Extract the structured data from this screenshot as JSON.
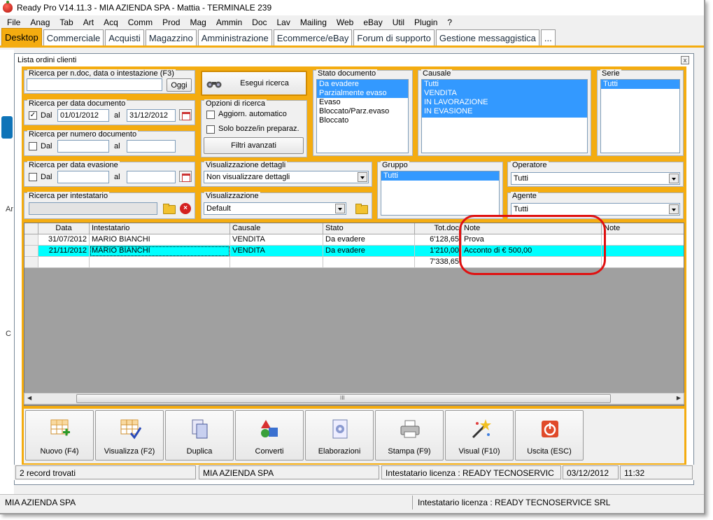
{
  "window": {
    "title": "Ready Pro V14.11.3 - MIA AZIENDA SPA - Mattia - TERMINALE 239"
  },
  "menu": [
    "File",
    "Anag",
    "Tab",
    "Art",
    "Acq",
    "Comm",
    "Prod",
    "Mag",
    "Ammin",
    "Doc",
    "Lav",
    "Mailing",
    "Web",
    "eBay",
    "Util",
    "Plugin",
    "?"
  ],
  "tabs": [
    "Desktop",
    "Commerciale",
    "Acquisti",
    "Magazzino",
    "Amministrazione",
    "Ecommerce/eBay",
    "Forum di supporto",
    "Gestione messaggistica",
    "..."
  ],
  "desk_left_letters": [
    "Ar",
    "C"
  ],
  "inner": {
    "title": "Lista ordini clienti",
    "close": "x"
  },
  "search": {
    "ndoc_title": "Ricerca per n.doc, data o intestazione (F3)",
    "ndoc_value": "",
    "oggi": "Oggi",
    "datadoc_title": "Ricerca per data documento",
    "dal": "Dal",
    "al": "al",
    "datadoc_checked": "✓",
    "datadoc_from": "01/01/2012",
    "datadoc_to": "31/12/2012",
    "numdoc_title": "Ricerca per numero documento",
    "dataev_title": "Ricerca per data evasione",
    "intest_title": "Ricerca per intestatario",
    "esegui": "Esegui ricerca",
    "opzioni_title": "Opzioni di ricerca",
    "opt_aggiorn": "Aggiorn. automatico",
    "opt_bozze": "Solo bozze/in preparaz.",
    "filtri": "Filtri avanzati",
    "visdett_title": "Visualizzazione dettagli",
    "visdett_value": "Non visualizzare dettagli",
    "vis_title": "Visualizzazione",
    "vis_value": "Default"
  },
  "stato": {
    "title": "Stato documento",
    "items": [
      {
        "label": "Da evadere",
        "sel": true
      },
      {
        "label": "Parzialmente evaso",
        "sel": true
      },
      {
        "label": "Evaso",
        "sel": false
      },
      {
        "label": "Bloccato/Parz.evaso",
        "sel": false
      },
      {
        "label": "Bloccato",
        "sel": false
      }
    ]
  },
  "causale": {
    "title": "Causale",
    "items": [
      "Tutti",
      "VENDITA",
      "IN LAVORAZIONE",
      "IN EVASIONE"
    ]
  },
  "serie": {
    "title": "Serie",
    "items": [
      "Tutti"
    ]
  },
  "gruppo": {
    "title": "Gruppo",
    "items": [
      "Tutti"
    ]
  },
  "operatore": {
    "title": "Operatore",
    "value": "Tutti"
  },
  "agente": {
    "title": "Agente",
    "value": "Tutti"
  },
  "grid": {
    "columns": [
      "Data",
      "Intestatario",
      "Causale",
      "Stato",
      "Tot.doc",
      "Note",
      "Note"
    ],
    "rows": [
      [
        "31/07/2012",
        "MARIO BIANCHI",
        "VENDITA",
        "Da evadere",
        "6'128,65",
        "Prova",
        ""
      ],
      [
        "21/11/2012",
        "MARIO BIANCHI",
        "VENDITA",
        "Da evadere",
        "1'210,00",
        "Acconto di  € 500,00",
        ""
      ]
    ],
    "total": "7'338,65",
    "scroll_grip": "III"
  },
  "buttons": [
    "Nuovo (F4)",
    "Visualizza (F2)",
    "Duplica",
    "Converti",
    "Elaborazioni",
    "Stampa (F9)",
    "Visual (F10)",
    "Uscita (ESC)"
  ],
  "status": {
    "records": "2 record trovati",
    "company": "MIA AZIENDA SPA",
    "license": "Intestatario licenza : READY TECNOSERVIC",
    "date": "03/12/2012",
    "time": "11:32"
  },
  "bottom": {
    "company": "MIA AZIENDA SPA",
    "license": "Intestatario licenza : READY TECNOSERVICE SRL"
  },
  "colors": {
    "accent": "#f4ac10",
    "selection": "#3399ff",
    "highlight_row": "#00ffff",
    "annotation_ring": "#e01010"
  }
}
